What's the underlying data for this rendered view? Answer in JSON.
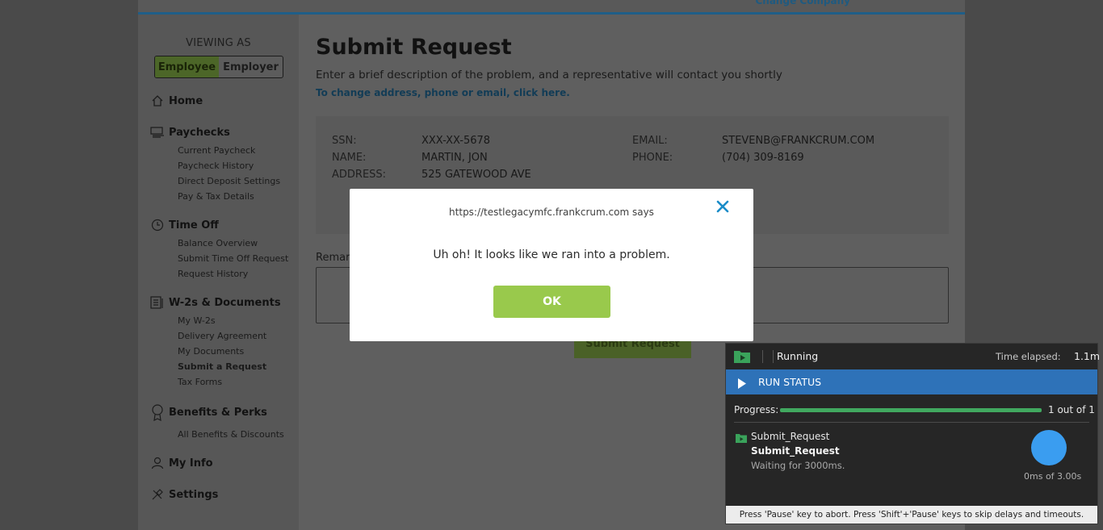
{
  "header": {
    "change_company": "Change Company"
  },
  "sidebar": {
    "viewing_as": "VIEWING AS",
    "toggle": {
      "employee": "Employee",
      "employer": "Employer",
      "active": "Employee"
    },
    "sections": [
      {
        "label": "Home",
        "icon": "home-icon",
        "items": []
      },
      {
        "label": "Paychecks",
        "icon": "paycheck-icon",
        "items": [
          "Current Paycheck",
          "Paycheck History",
          "Direct Deposit Settings",
          "Pay & Tax Details"
        ]
      },
      {
        "label": "Time Off",
        "icon": "clock-icon",
        "items": [
          "Balance Overview",
          "Submit Time Off Request",
          "Request History"
        ]
      },
      {
        "label": "W-2s & Documents",
        "icon": "documents-icon",
        "items": [
          "My W-2s",
          "Delivery Agreement",
          "My Documents",
          "Submit a Request",
          "Tax Forms"
        ]
      },
      {
        "label": "Benefits & Perks",
        "icon": "benefits-icon",
        "items": [
          "All Benefits & Discounts"
        ]
      },
      {
        "label": "My Info",
        "icon": "user-icon",
        "items": []
      },
      {
        "label": "Settings",
        "icon": "settings-icon",
        "items": []
      }
    ],
    "active_item": "Submit a Request"
  },
  "main": {
    "title": "Submit Request",
    "subtitle": "Enter a brief description of the problem, and a representative will contact you shortly",
    "change_link": "To change address, phone or email, click here.",
    "info": {
      "ssn_label": "SSN:",
      "ssn": "XXX-XX-5678",
      "name_label": "NAME:",
      "name": "MARTIN, JON",
      "address_label": "ADDRESS:",
      "address": "525 GATEWOOD AVE",
      "email_label": "EMAIL:",
      "email": "STEVENB@FRANKCRUM.COM",
      "phone_label": "PHONE:",
      "phone": "(704) 309-8169"
    },
    "remarks_label": "Remarks",
    "submit_label": "Submit Request"
  },
  "dialog": {
    "origin": "https://testlegacymfc.frankcrum.com says",
    "message": "Uh oh! It looks like we ran into a problem.",
    "ok_label": "OK"
  },
  "runner": {
    "state": "Running",
    "elapsed_label": "Time elapsed:",
    "elapsed": "1.1m",
    "section_title": "RUN STATUS",
    "progress_label": "Progress:",
    "progress_text": "1 out of 1",
    "progress_fraction": 1.0,
    "step_name": "Submit_Request",
    "step_action": "Submit_Request",
    "step_wait": "Waiting for 3000ms.",
    "timer": "0ms of 3.00s",
    "footer": "Press 'Pause' key to abort. Press 'Shift'+'Pause' keys to skip delays and timeouts.",
    "colors": {
      "accent": "#2e72b8",
      "progress": "#41a85f",
      "circle": "#3a9df0"
    }
  }
}
